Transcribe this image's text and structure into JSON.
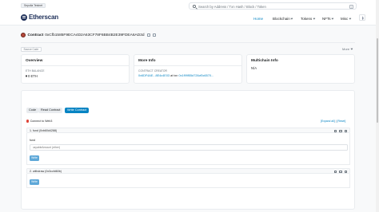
{
  "network_badge": "Sepolia Testnet",
  "logo_text": "Etherscan",
  "search": {
    "placeholder": "Search by Address / Txn Hash / Block / Token",
    "shortcut": "/"
  },
  "nav": {
    "home": "Home",
    "blockchain": "Blockchain",
    "tokens": "Tokens",
    "nfts": "NFTs",
    "misc": "Misc"
  },
  "contract": {
    "label": "Contract",
    "address": "0xCfb1585F9ECA4D2A63CF78F6BB4B2E39FDEA6AD3d"
  },
  "source_tag": "Source Code",
  "more_label": "More",
  "overview": {
    "title": "Overview",
    "balance_label": "ETH BALANCE",
    "balance_value": "0 ETH"
  },
  "more_info": {
    "title": "More Info",
    "creator_label": "CONTRACT CREATOR",
    "creator_address": "0x6DF4AE...8E4c4E03",
    "creator_at": "at txn",
    "creator_txn": "0x1f99f55d726cf0c6570..."
  },
  "multichain": {
    "title": "Multichain Info",
    "value": "N/A"
  },
  "tabs": {
    "transactions": "Transactions",
    "internal": "Internal Transactions",
    "token_transfers": "Token Transfers (ERC-20)",
    "contract": "Contract",
    "events": "Events"
  },
  "subtabs": {
    "code": "Code",
    "read": "Read Contract",
    "write": "Write Contract"
  },
  "connect_label": "Connect to Web3",
  "expand": {
    "expand_all": "[Expand all]",
    "reset": "[Reset]",
    "separator": "|"
  },
  "functions": [
    {
      "title": "1. fund (0xb60d4288)",
      "param_label": "fund",
      "param_placeholder": "payableAmount (ether)",
      "button": "Write"
    },
    {
      "title": "2. withdraw (0x3ccfd60b)",
      "button": "Write"
    }
  ],
  "colors": {
    "brand": "#21325b",
    "link": "#0784c3",
    "write_button": "#5ea8d8",
    "disconnected": "#de4437"
  }
}
